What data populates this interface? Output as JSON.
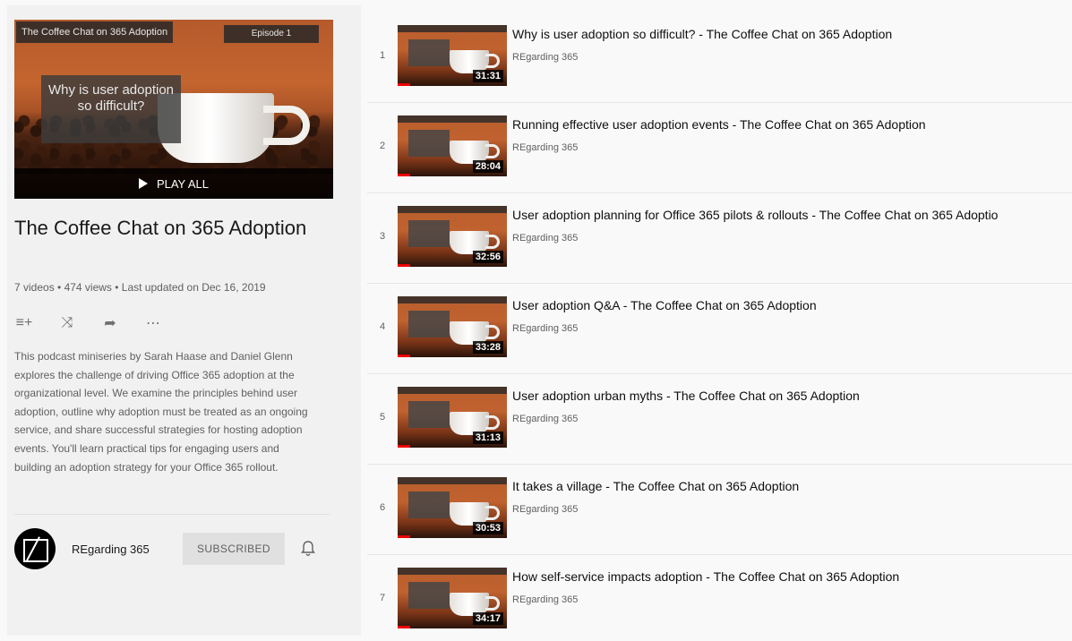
{
  "playlist": {
    "thumbnail_title_tag": "The Coffee Chat on 365 Adoption",
    "thumbnail_episode_tag": "Episode 1",
    "thumbnail_overlay_text": "Why is user adoption so difficult?",
    "play_all_label": "PLAY ALL",
    "title": "The Coffee Chat on 365 Adoption",
    "stats": "7 videos • 474 views • Last updated on Dec 16, 2019",
    "description": "This podcast miniseries by Sarah Haase and Daniel Glenn explores the challenge of driving Office 365 adoption at the organizational level. We examine the principles behind user adoption, outline why adoption must be treated as an ongoing service, and share successful strategies for hosting adoption events. You'll learn practical tips for engaging users and building an adoption strategy for your Office 365 rollout.",
    "actions": [
      {
        "name": "add-to-queue-icon",
        "glyph": "≡+"
      },
      {
        "name": "shuffle-icon",
        "glyph": "⤨"
      },
      {
        "name": "share-icon",
        "glyph": "➦"
      },
      {
        "name": "more-icon",
        "glyph": "⋯"
      }
    ]
  },
  "owner": {
    "name": "REgarding 365",
    "subscribe_label": "SUBSCRIBED",
    "bell_glyph": "🔔"
  },
  "videos": [
    {
      "index": "1",
      "title": "Why is user adoption so difficult? - The Coffee Chat on 365 Adoption",
      "channel": "REgarding 365",
      "duration": "31:31"
    },
    {
      "index": "2",
      "title": "Running effective user adoption events - The Coffee Chat on 365 Adoption",
      "channel": "REgarding 365",
      "duration": "28:04"
    },
    {
      "index": "3",
      "title": "User adoption planning for Office 365 pilots & rollouts - The Coffee Chat on 365 Adoptio",
      "channel": "REgarding 365",
      "duration": "32:56"
    },
    {
      "index": "4",
      "title": "User adoption Q&A - The Coffee Chat on 365 Adoption",
      "channel": "REgarding 365",
      "duration": "33:28"
    },
    {
      "index": "5",
      "title": "User adoption urban myths - The Coffee Chat on 365 Adoption",
      "channel": "REgarding 365",
      "duration": "31:13"
    },
    {
      "index": "6",
      "title": "It takes a village - The Coffee Chat on 365 Adoption",
      "channel": "REgarding 365",
      "duration": "30:53"
    },
    {
      "index": "7",
      "title": "How self-service impacts adoption - The Coffee Chat on 365 Adoption",
      "channel": "REgarding 365",
      "duration": "34:17"
    }
  ]
}
